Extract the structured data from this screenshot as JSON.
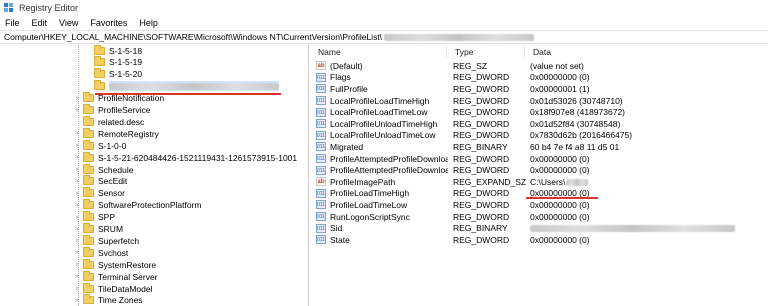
{
  "window": {
    "title": "Registry Editor"
  },
  "menu": [
    "File",
    "Edit",
    "View",
    "Favorites",
    "Help"
  ],
  "address": {
    "path": "Computer\\HKEY_LOCAL_MACHINE\\SOFTWARE\\Microsoft\\Windows NT\\CurrentVersion\\ProfileList\\"
  },
  "tree": {
    "items": [
      {
        "label": "S-1-5-18",
        "expandable": false
      },
      {
        "label": "S-1-5-19",
        "expandable": false
      },
      {
        "label": "S-1-5-20",
        "expandable": false
      },
      {
        "label": "",
        "expandable": false,
        "redacted": true,
        "selected": true
      },
      {
        "label": "ProfileNotification",
        "expandable": true
      },
      {
        "label": "ProfileService",
        "expandable": true
      },
      {
        "label": "related.desc",
        "expandable": false
      },
      {
        "label": "RemoteRegistry",
        "expandable": true
      },
      {
        "label": "S-1-0-0",
        "expandable": true
      },
      {
        "label": "S-1-5-21-620484426-1521119431-1261573915-1001",
        "expandable": true
      },
      {
        "label": "Schedule",
        "expandable": true
      },
      {
        "label": "SecEdit",
        "expandable": true
      },
      {
        "label": "Sensor",
        "expandable": true
      },
      {
        "label": "SoftwareProtectionPlatform",
        "expandable": true
      },
      {
        "label": "SPP",
        "expandable": true
      },
      {
        "label": "SRUM",
        "expandable": true
      },
      {
        "label": "Superfetch",
        "expandable": true
      },
      {
        "label": "Svchost",
        "expandable": true
      },
      {
        "label": "SystemRestore",
        "expandable": true
      },
      {
        "label": "Terminal Server",
        "expandable": true
      },
      {
        "label": "TileDataModel",
        "expandable": true
      },
      {
        "label": "Time Zones",
        "expandable": true
      }
    ]
  },
  "columns": {
    "name": "Name",
    "type": "Type",
    "data": "Data"
  },
  "values": [
    {
      "name": "(Default)",
      "type": "REG_SZ",
      "data": "(value not set)",
      "icon": "string-value-icon"
    },
    {
      "name": "Flags",
      "type": "REG_DWORD",
      "data": "0x00000000 (0)",
      "icon": "binary-value-icon"
    },
    {
      "name": "FullProfile",
      "type": "REG_DWORD",
      "data": "0x00000001 (1)",
      "icon": "binary-value-icon"
    },
    {
      "name": "LocalProfileLoadTimeHigh",
      "type": "REG_DWORD",
      "data": "0x01d53026 (30748710)",
      "icon": "binary-value-icon"
    },
    {
      "name": "LocalProfileLoadTimeLow",
      "type": "REG_DWORD",
      "data": "0x18f907e8 (418973672)",
      "icon": "binary-value-icon"
    },
    {
      "name": "LocalProfileUnloadTimeHigh",
      "type": "REG_DWORD",
      "data": "0x01d52f84 (30748548)",
      "icon": "binary-value-icon"
    },
    {
      "name": "LocalProfileUnloadTimeLow",
      "type": "REG_DWORD",
      "data": "0x7830d62b (2016466475)",
      "icon": "binary-value-icon"
    },
    {
      "name": "Migrated",
      "type": "REG_BINARY",
      "data": "60 b4 7e f4 a8 11 d5 01",
      "icon": "binary-value-icon"
    },
    {
      "name": "ProfileAttemptedProfileDownloa...",
      "type": "REG_DWORD",
      "data": "0x00000000 (0)",
      "icon": "binary-value-icon"
    },
    {
      "name": "ProfileAttemptedProfileDownloa...",
      "type": "REG_DWORD",
      "data": "0x00000000 (0)",
      "icon": "binary-value-icon"
    },
    {
      "name": "ProfileImagePath",
      "type": "REG_EXPAND_SZ",
      "data": "C:\\Users\\",
      "icon": "string-value-icon",
      "redacted_suffix": true
    },
    {
      "name": "ProfileLoadTimeHigh",
      "type": "REG_DWORD",
      "data": "0x00000000 (0)",
      "icon": "binary-value-icon"
    },
    {
      "name": "ProfileLoadTimeLow",
      "type": "REG_DWORD",
      "data": "0x00000000 (0)",
      "icon": "binary-value-icon"
    },
    {
      "name": "RunLogonScriptSync",
      "type": "REG_DWORD",
      "data": "0x00000000 (0)",
      "icon": "binary-value-icon"
    },
    {
      "name": "Sid",
      "type": "REG_BINARY",
      "data": "",
      "icon": "binary-value-icon",
      "redacted": true
    },
    {
      "name": "State",
      "type": "REG_DWORD",
      "data": "0x00000000 (0)",
      "icon": "binary-value-icon"
    }
  ],
  "colors": {
    "selection": "#cce8ff",
    "highlight_underline": "#d9332b",
    "folder": "#f2cf60"
  }
}
